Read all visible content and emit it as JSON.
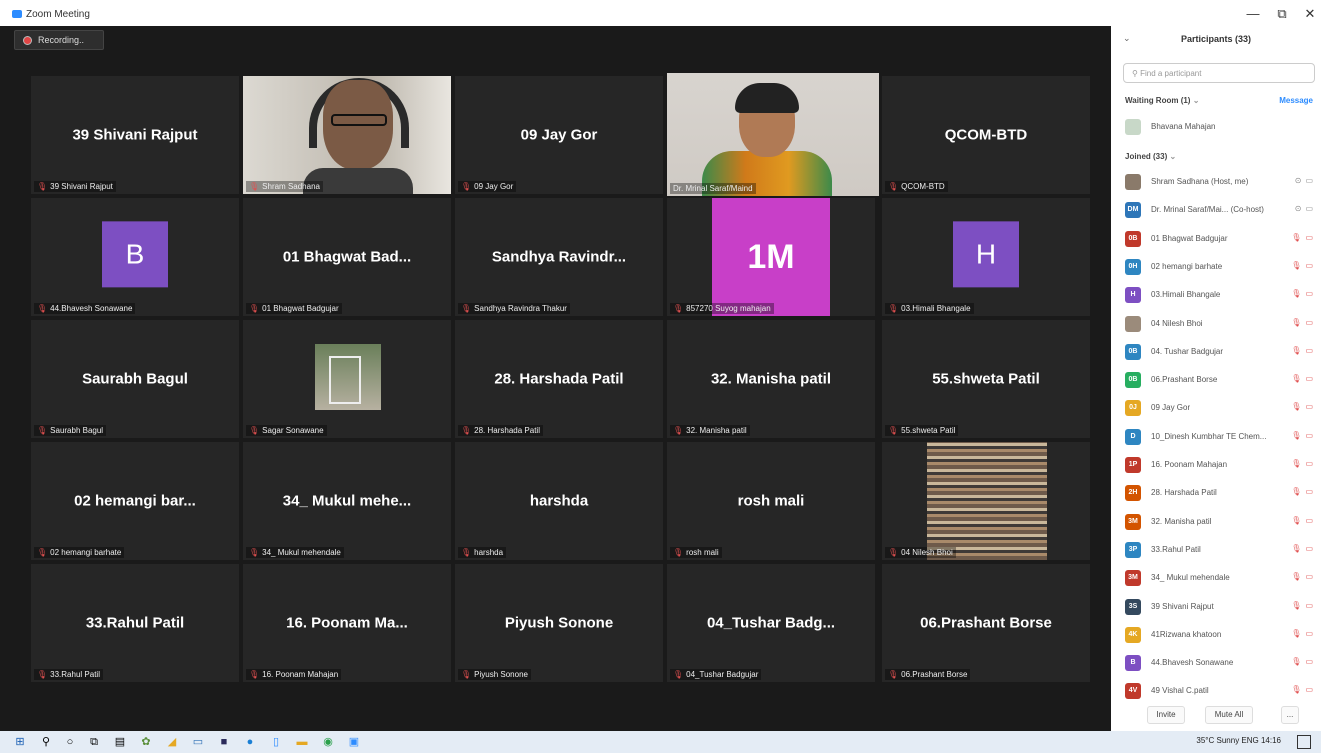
{
  "window": {
    "title": "Zoom Meeting",
    "minimize": "—",
    "restore": "⧉",
    "close": "✕"
  },
  "recording": {
    "label": "Recording.."
  },
  "tiles": [
    {
      "big": "39 Shivani Rajput",
      "label": "39 Shivani Rajput"
    },
    {
      "big": "",
      "label": "Shram Sadhana"
    },
    {
      "big": "09 Jay Gor",
      "label": "09 Jay Gor"
    },
    {
      "big": "",
      "label": "Dr. Mrinal Saraf/Maind"
    },
    {
      "big": "QCOM-BTD",
      "label": "QCOM-BTD"
    },
    {
      "big": "",
      "avatar": "B",
      "label": "44.Bhavesh Sonawane"
    },
    {
      "big": "01 Bhagwat Bad...",
      "label": "01 Bhagwat Badgujar"
    },
    {
      "big": "Sandhya Ravindr...",
      "label": "Sandhya Ravindra Thakur"
    },
    {
      "big": "",
      "avatar": "1M",
      "label": "857270 Suyog mahajan"
    },
    {
      "big": "",
      "avatar": "H",
      "label": "03.Himali Bhangale"
    },
    {
      "big": "Saurabh Bagul",
      "label": "Saurabh Bagul"
    },
    {
      "big": "",
      "label": "Sagar Sonawane"
    },
    {
      "big": "28. Harshada Patil",
      "label": "28. Harshada Patil"
    },
    {
      "big": "32. Manisha patil",
      "label": "32. Manisha patil"
    },
    {
      "big": "55.shweta Patil",
      "label": "55.shweta Patil"
    },
    {
      "big": "02 hemangi bar...",
      "label": "02 hemangi barhate"
    },
    {
      "big": "34_ Mukul mehe...",
      "label": "34_ Mukul mehendale"
    },
    {
      "big": "harshda",
      "label": "harshda"
    },
    {
      "big": "rosh mali",
      "label": "rosh mali"
    },
    {
      "big": "",
      "label": "04 Nilesh Bhoi"
    },
    {
      "big": "33.Rahul Patil",
      "label": "33.Rahul Patil"
    },
    {
      "big": "16. Poonam Ma...",
      "label": "16. Poonam Mahajan"
    },
    {
      "big": "Piyush Sonone",
      "label": "Piyush Sonone"
    },
    {
      "big": "04_Tushar Badg...",
      "label": "04_Tushar Badgujar"
    },
    {
      "big": "06.Prashant Borse",
      "label": "06.Prashant Borse"
    }
  ],
  "panel": {
    "title": "Participants (33)",
    "search_placeholder": "Find a participant",
    "waiting_label": "Waiting Room (1)",
    "message": "Message",
    "waiting_person": "Bhavana Mahajan",
    "joined_label": "Joined (33)",
    "participants": [
      {
        "initials": "",
        "name": "Shram Sadhana (Host, me)",
        "color": "#8a7a6a"
      },
      {
        "initials": "DM",
        "name": "Dr. Mrinal Saraf/Mai... (Co-host)",
        "color": "#2e76b8"
      },
      {
        "initials": "0B",
        "name": "01 Bhagwat Badgujar",
        "color": "#c0392b"
      },
      {
        "initials": "0H",
        "name": "02 hemangi barhate",
        "color": "#2e86c1"
      },
      {
        "initials": "H",
        "name": "03.Himali Bhangale",
        "color": "#7d4fc2"
      },
      {
        "initials": "",
        "name": "04 Nilesh Bhoi",
        "color": "#9b8b7b"
      },
      {
        "initials": "0B",
        "name": "04. Tushar Badgujar",
        "color": "#2e86c1"
      },
      {
        "initials": "0B",
        "name": "06.Prashant Borse",
        "color": "#27ae60"
      },
      {
        "initials": "0J",
        "name": "09 Jay Gor",
        "color": "#e5a823"
      },
      {
        "initials": "D",
        "name": "10_Dinesh Kumbhar TE Chem...",
        "color": "#2e86c1"
      },
      {
        "initials": "1P",
        "name": "16. Poonam Mahajan",
        "color": "#c0392b"
      },
      {
        "initials": "2H",
        "name": "28. Harshada Patil",
        "color": "#d35400"
      },
      {
        "initials": "3M",
        "name": "32. Manisha patil",
        "color": "#d35400"
      },
      {
        "initials": "3P",
        "name": "33.Rahul Patil",
        "color": "#2e86c1"
      },
      {
        "initials": "3M",
        "name": "34_ Mukul mehendale",
        "color": "#c0392b"
      },
      {
        "initials": "3S",
        "name": "39 Shivani Rajput",
        "color": "#34495e"
      },
      {
        "initials": "4K",
        "name": "41Rizwana khatoon",
        "color": "#e5a823"
      },
      {
        "initials": "B",
        "name": "44.Bhavesh Sonawane",
        "color": "#7d4fc2"
      },
      {
        "initials": "4V",
        "name": "49 Vishal C.patil",
        "color": "#c0392b"
      }
    ],
    "invite": "Invite",
    "mute_all": "Mute All",
    "more": "..."
  },
  "taskbar": {
    "tray": "35°C Sunny  ENG  14:16"
  },
  "colors": {
    "active_border": "#a8d12a",
    "avatar_purple": "#7d4fc2",
    "avatar_pink": "#c83fc8",
    "accent_blue": "#2d8cff"
  }
}
